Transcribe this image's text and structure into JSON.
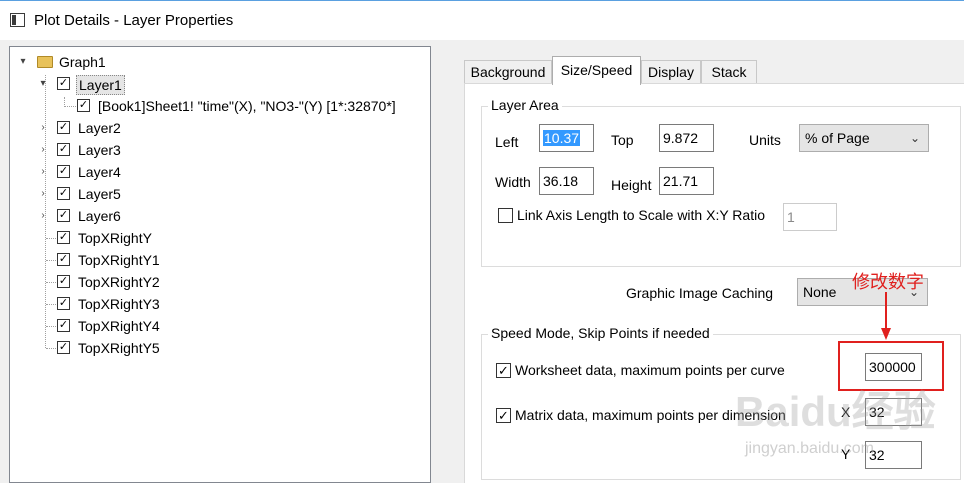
{
  "window": {
    "title": "Plot Details - Layer Properties"
  },
  "tree": {
    "root": {
      "label": "Graph1"
    },
    "layer1": {
      "label": "Layer1",
      "expanded": true,
      "selected": true
    },
    "dataset": {
      "label": "[Book1]Sheet1! \"time\"(X), \"NO3-\"(Y) [1*:32870*]"
    },
    "nodes": [
      {
        "label": "Layer2"
      },
      {
        "label": "Layer3"
      },
      {
        "label": "Layer4"
      },
      {
        "label": "Layer5"
      },
      {
        "label": "Layer6"
      },
      {
        "label": "TopXRightY"
      },
      {
        "label": "TopXRightY1"
      },
      {
        "label": "TopXRightY2"
      },
      {
        "label": "TopXRightY3"
      },
      {
        "label": "TopXRightY4"
      },
      {
        "label": "TopXRightY5"
      }
    ]
  },
  "tabs": [
    {
      "label": "Background"
    },
    {
      "label": "Size/Speed",
      "active": true
    },
    {
      "label": "Display"
    },
    {
      "label": "Stack"
    }
  ],
  "layer_area": {
    "title": "Layer Area",
    "left_label": "Left",
    "left_value": "10.37",
    "top_label": "Top",
    "top_value": "9.872",
    "units_label": "Units",
    "units_value": "% of Page",
    "width_label": "Width",
    "width_value": "36.18",
    "height_label": "Height",
    "height_value": "21.71",
    "link_label": "Link Axis Length to Scale with X:Y Ratio",
    "link_checked": false,
    "ratio_value": "1"
  },
  "caching": {
    "label": "Graphic Image Caching",
    "value": "None"
  },
  "speed_mode": {
    "title": "Speed Mode, Skip Points if needed",
    "worksheet_label": "Worksheet data, maximum points per curve",
    "worksheet_checked": true,
    "worksheet_value": "300000",
    "matrix_label": "Matrix data, maximum points per dimension",
    "matrix_checked": true,
    "x_label": "X",
    "x_value": "32",
    "y_label": "Y",
    "y_value": "32"
  },
  "annotation": {
    "text": "修改数字",
    "color": "#e0201e"
  },
  "watermark": {
    "text": "Baidu经验",
    "sub": "jingyan.baidu.com"
  },
  "icons": {
    "title": "window-icon",
    "folder": "folder-icon",
    "checkbox": "check-icon",
    "dropdown": "chevron-down-icon"
  }
}
